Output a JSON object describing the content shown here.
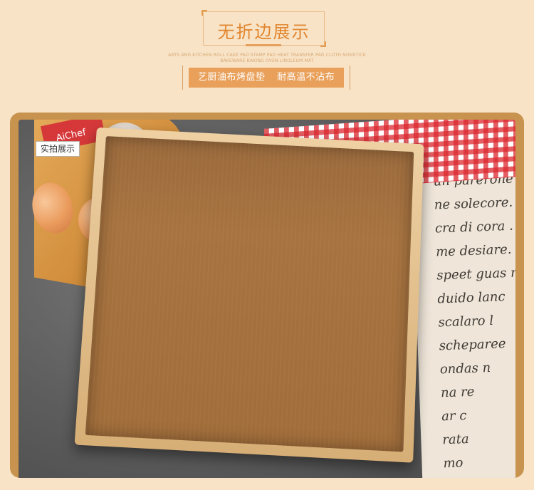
{
  "header": {
    "title": "无折边展示",
    "subtitle_en": "ARTS AND KITCHEN ROLL CAKE PAD STAMP PAD HEAT TRANSFER PAD CLOTH NONSTICK BAKEWARE BAKING OVEN LINOLEUM MAT",
    "banner_left": "艺厨油布烤盘垫",
    "banner_right": "耐高温不沾布"
  },
  "photo": {
    "tag_label": "实拍展示",
    "package_brand": "AiChef",
    "paper_lines": [
      "un parerone lo",
      "ne solecore. Co",
      "cra di cora . n",
      "me desiare. B",
      "speet guas m",
      "duido lanc",
      "scalaro l",
      "scheparee",
      "ondas n",
      "na re",
      "ar c",
      "rata",
      "mo"
    ]
  },
  "colors": {
    "background": "#f8e3c6",
    "accent": "#e1862f",
    "banner": "#e9a05a",
    "frame": "#c8934e"
  }
}
